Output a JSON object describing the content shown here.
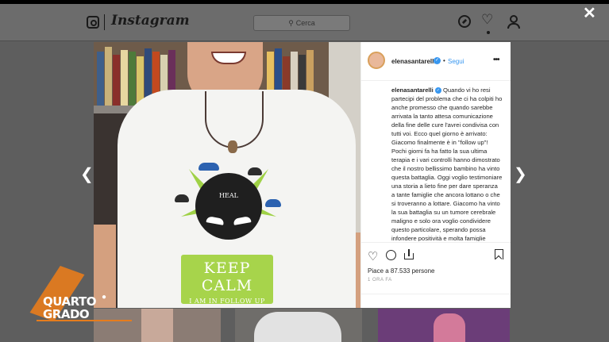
{
  "header": {
    "logo_text": "Instagram",
    "search_placeholder": "Cerca",
    "icons": [
      "instagram-camera-icon",
      "compass-icon",
      "heart-icon",
      "user-icon"
    ]
  },
  "post": {
    "username": "elenasantarelli",
    "follow_label": "Segui",
    "caption_user": "elenasantarelli",
    "caption_text": "Quando vi ho resi partecipi del problema che ci ha colpiti ho anche promesso che quando sarebbe arrivata la tanto attesa comunicazione della fine delle cure l'avrei condivisa con tutti voi. Ecco quel giorno è arrivato: Giacomo finalmente è in \"follow up\"! Pochi giorni fa ha fatto la sua ultima terapia e i vari controlli hanno dimostrato che il nostro bellissimo bambino ha vinto questa battaglia. Oggi voglio testimoniare una storia a lieto fine per dare speranza a tante famiglie che ancora lottano o che si troveranno a lottare. Giacomo ha vinto la sua battaglia su un tumore cerebrale maligno e solo ora voglio condividere questo particolare, sperando possa infondere positività e molta famiglie",
    "likes": "Piace a 87.533 persone",
    "date": "1 ORA FA"
  },
  "shirt": {
    "logo_text": "HEAL",
    "line1": "KEEP CALM",
    "line2": "I AM IN FOLLOW UP"
  },
  "tv_logo": {
    "line1": "QUARTO",
    "line2": "GRADO"
  },
  "colors": {
    "accent_blue": "#3897f0",
    "overlay": "#5e5e5e",
    "shirt_green": "#a7d44b",
    "tv_orange": "#e57c1d"
  }
}
